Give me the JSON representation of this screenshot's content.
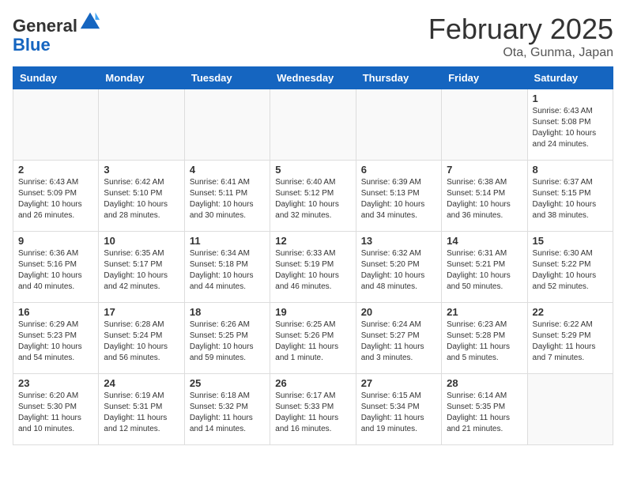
{
  "header": {
    "logo": {
      "general": "General",
      "blue": "Blue"
    },
    "title": "February 2025",
    "location": "Ota, Gunma, Japan"
  },
  "weekdays": [
    "Sunday",
    "Monday",
    "Tuesday",
    "Wednesday",
    "Thursday",
    "Friday",
    "Saturday"
  ],
  "weeks": [
    [
      {
        "day": "",
        "info": ""
      },
      {
        "day": "",
        "info": ""
      },
      {
        "day": "",
        "info": ""
      },
      {
        "day": "",
        "info": ""
      },
      {
        "day": "",
        "info": ""
      },
      {
        "day": "",
        "info": ""
      },
      {
        "day": "1",
        "info": "Sunrise: 6:43 AM\nSunset: 5:08 PM\nDaylight: 10 hours\nand 24 minutes."
      }
    ],
    [
      {
        "day": "2",
        "info": "Sunrise: 6:43 AM\nSunset: 5:09 PM\nDaylight: 10 hours\nand 26 minutes."
      },
      {
        "day": "3",
        "info": "Sunrise: 6:42 AM\nSunset: 5:10 PM\nDaylight: 10 hours\nand 28 minutes."
      },
      {
        "day": "4",
        "info": "Sunrise: 6:41 AM\nSunset: 5:11 PM\nDaylight: 10 hours\nand 30 minutes."
      },
      {
        "day": "5",
        "info": "Sunrise: 6:40 AM\nSunset: 5:12 PM\nDaylight: 10 hours\nand 32 minutes."
      },
      {
        "day": "6",
        "info": "Sunrise: 6:39 AM\nSunset: 5:13 PM\nDaylight: 10 hours\nand 34 minutes."
      },
      {
        "day": "7",
        "info": "Sunrise: 6:38 AM\nSunset: 5:14 PM\nDaylight: 10 hours\nand 36 minutes."
      },
      {
        "day": "8",
        "info": "Sunrise: 6:37 AM\nSunset: 5:15 PM\nDaylight: 10 hours\nand 38 minutes."
      }
    ],
    [
      {
        "day": "9",
        "info": "Sunrise: 6:36 AM\nSunset: 5:16 PM\nDaylight: 10 hours\nand 40 minutes."
      },
      {
        "day": "10",
        "info": "Sunrise: 6:35 AM\nSunset: 5:17 PM\nDaylight: 10 hours\nand 42 minutes."
      },
      {
        "day": "11",
        "info": "Sunrise: 6:34 AM\nSunset: 5:18 PM\nDaylight: 10 hours\nand 44 minutes."
      },
      {
        "day": "12",
        "info": "Sunrise: 6:33 AM\nSunset: 5:19 PM\nDaylight: 10 hours\nand 46 minutes."
      },
      {
        "day": "13",
        "info": "Sunrise: 6:32 AM\nSunset: 5:20 PM\nDaylight: 10 hours\nand 48 minutes."
      },
      {
        "day": "14",
        "info": "Sunrise: 6:31 AM\nSunset: 5:21 PM\nDaylight: 10 hours\nand 50 minutes."
      },
      {
        "day": "15",
        "info": "Sunrise: 6:30 AM\nSunset: 5:22 PM\nDaylight: 10 hours\nand 52 minutes."
      }
    ],
    [
      {
        "day": "16",
        "info": "Sunrise: 6:29 AM\nSunset: 5:23 PM\nDaylight: 10 hours\nand 54 minutes."
      },
      {
        "day": "17",
        "info": "Sunrise: 6:28 AM\nSunset: 5:24 PM\nDaylight: 10 hours\nand 56 minutes."
      },
      {
        "day": "18",
        "info": "Sunrise: 6:26 AM\nSunset: 5:25 PM\nDaylight: 10 hours\nand 59 minutes."
      },
      {
        "day": "19",
        "info": "Sunrise: 6:25 AM\nSunset: 5:26 PM\nDaylight: 11 hours\nand 1 minute."
      },
      {
        "day": "20",
        "info": "Sunrise: 6:24 AM\nSunset: 5:27 PM\nDaylight: 11 hours\nand 3 minutes."
      },
      {
        "day": "21",
        "info": "Sunrise: 6:23 AM\nSunset: 5:28 PM\nDaylight: 11 hours\nand 5 minutes."
      },
      {
        "day": "22",
        "info": "Sunrise: 6:22 AM\nSunset: 5:29 PM\nDaylight: 11 hours\nand 7 minutes."
      }
    ],
    [
      {
        "day": "23",
        "info": "Sunrise: 6:20 AM\nSunset: 5:30 PM\nDaylight: 11 hours\nand 10 minutes."
      },
      {
        "day": "24",
        "info": "Sunrise: 6:19 AM\nSunset: 5:31 PM\nDaylight: 11 hours\nand 12 minutes."
      },
      {
        "day": "25",
        "info": "Sunrise: 6:18 AM\nSunset: 5:32 PM\nDaylight: 11 hours\nand 14 minutes."
      },
      {
        "day": "26",
        "info": "Sunrise: 6:17 AM\nSunset: 5:33 PM\nDaylight: 11 hours\nand 16 minutes."
      },
      {
        "day": "27",
        "info": "Sunrise: 6:15 AM\nSunset: 5:34 PM\nDaylight: 11 hours\nand 19 minutes."
      },
      {
        "day": "28",
        "info": "Sunrise: 6:14 AM\nSunset: 5:35 PM\nDaylight: 11 hours\nand 21 minutes."
      },
      {
        "day": "",
        "info": ""
      }
    ]
  ]
}
